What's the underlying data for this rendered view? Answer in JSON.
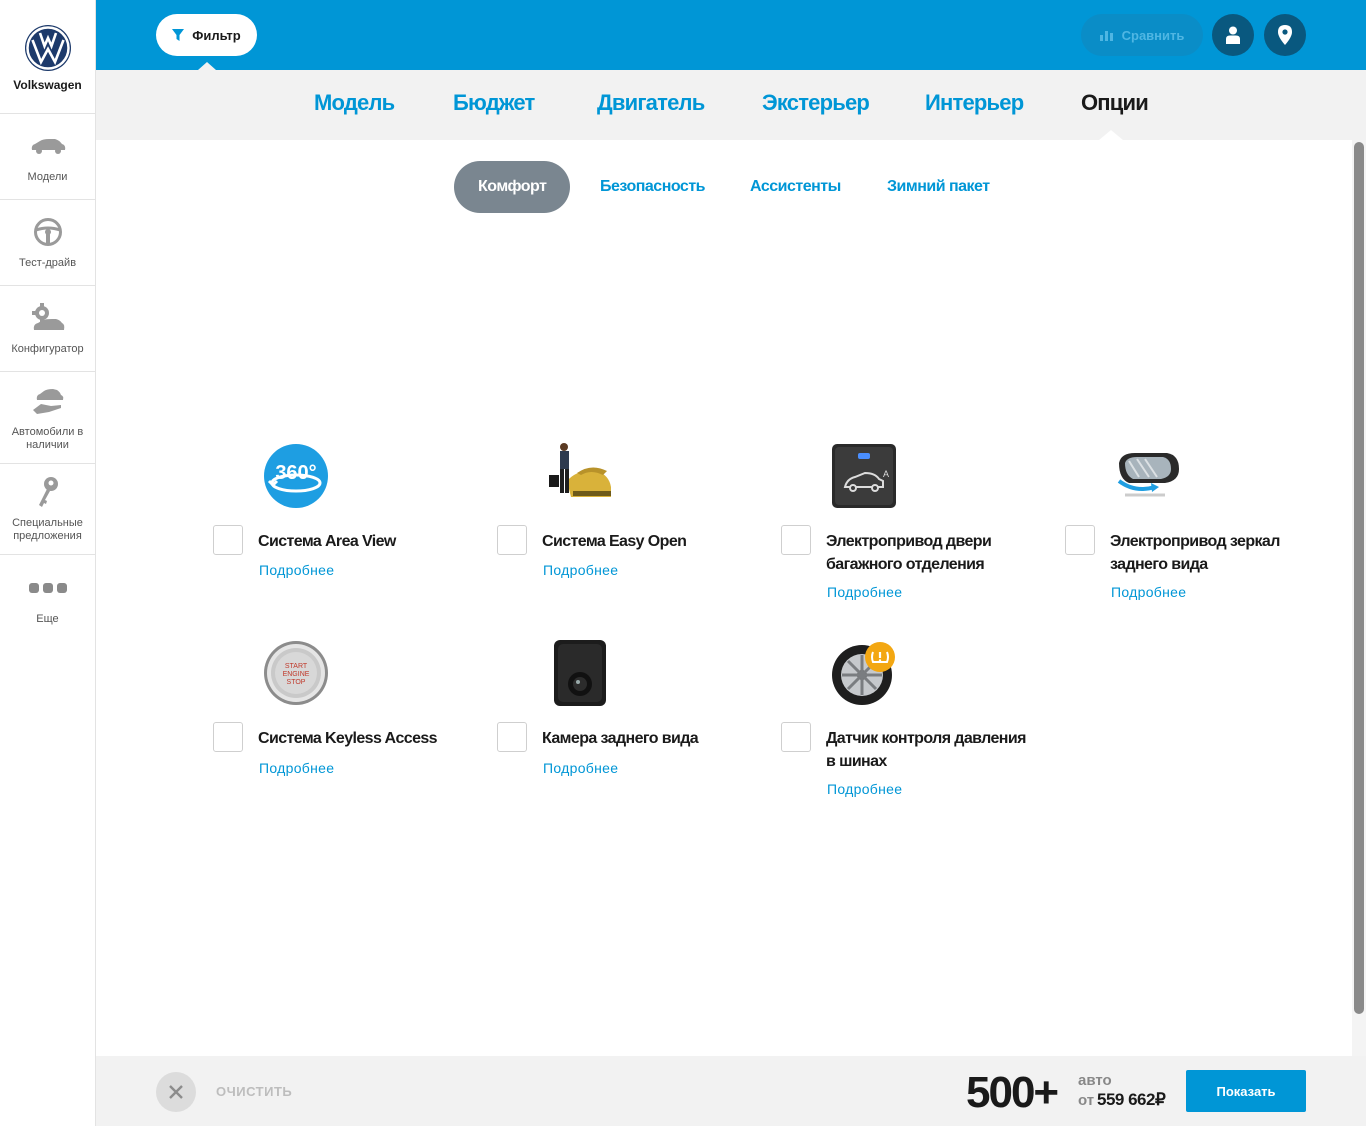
{
  "brand": {
    "name": "Volkswagen",
    "logo_icon": "vw-logo-icon"
  },
  "sidebar": {
    "items": [
      {
        "label": "Модели",
        "icon": "car-icon"
      },
      {
        "label": "Тест-драйв",
        "icon": "steering-wheel-icon"
      },
      {
        "label": "Конфигуратор",
        "icon": "gear-car-icon"
      },
      {
        "label": "Автомобили в наличии",
        "icon": "car-hand-icon"
      },
      {
        "label": "Специальные предложения",
        "icon": "keys-icon"
      },
      {
        "label": "Еще",
        "icon": "more-dots-icon"
      }
    ]
  },
  "topbar": {
    "filter_label": "Фильтр",
    "compare_label": "Сравнить",
    "user_icon": "user-icon",
    "location_icon": "location-pin-icon"
  },
  "main_tabs": [
    "Модель",
    "Бюджет",
    "Двигатель",
    "Экстерьер",
    "Интерьер",
    "Опции"
  ],
  "active_main_tab": "Опции",
  "sub_tabs": [
    "Комфорт",
    "Безопасность",
    "Ассистенты",
    "Зимний пакет"
  ],
  "active_sub_tab": "Комфорт",
  "options": [
    {
      "title": "Система Area View",
      "link": "Подробнее",
      "image": "360-view-icon",
      "checked": false
    },
    {
      "title": "Система Easy Open",
      "link": "Подробнее",
      "image": "easy-open-photo",
      "checked": false
    },
    {
      "title": "Электропривод двери багажного отделения",
      "link": "Подробнее",
      "image": "trunk-button-photo",
      "checked": false
    },
    {
      "title": "Электропривод зеркал заднего вида",
      "link": "Подробнее",
      "image": "mirror-photo",
      "checked": false
    },
    {
      "title": "Система Keyless Access",
      "link": "Подробнее",
      "image": "start-engine-button-photo",
      "checked": false
    },
    {
      "title": "Камера заднего вида",
      "link": "Подробнее",
      "image": "rear-camera-photo",
      "checked": false
    },
    {
      "title": "Датчик контроля давления в шинах",
      "link": "Подробнее",
      "image": "tire-pressure-photo",
      "checked": false
    }
  ],
  "bottombar": {
    "clear_label": "ОЧИСТИТЬ",
    "count": "500+",
    "unit": "авто",
    "price_prefix": "от",
    "price": "559 662₽",
    "show_label": "Показать"
  },
  "colors": {
    "accent": "#0096d6",
    "topbar": "#0096d6",
    "dark_button": "#09587f",
    "active_subtab": "#7a8690"
  }
}
